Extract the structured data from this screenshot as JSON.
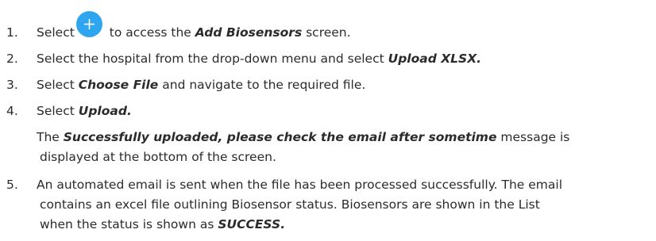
{
  "steps": [
    {
      "number": "1.",
      "pre": "Select",
      "icon": "add-circle-icon",
      "post_a": " to access the ",
      "bold": "Add Biosensors",
      "post_b": " screen."
    },
    {
      "number": "2.",
      "pre": "Select the hospital from the drop-down menu and select ",
      "bold": "Upload XLSX."
    },
    {
      "number": "3.",
      "pre": "Select ",
      "bold": "Choose File",
      "post": " and navigate to the required file."
    },
    {
      "number": "4.",
      "pre": "Select ",
      "bold": "Upload."
    },
    {
      "note_pre": "The ",
      "note_bold": "Successfully uploaded, please check the email after sometime",
      "note_post": " message is",
      "note_line2": "displayed at the bottom of the screen."
    },
    {
      "number": "5.",
      "line1": "An automated email is sent when the file has been processed successfully. The email",
      "line2": "contains an excel file outlining Biosensor status. Biosensors are shown in the List",
      "line3_pre": "when the status is shown as ",
      "line3_bold": "SUCCESS."
    }
  ],
  "colors": {
    "text": "#2b2b2b",
    "add_button": "#2ea6ef"
  }
}
